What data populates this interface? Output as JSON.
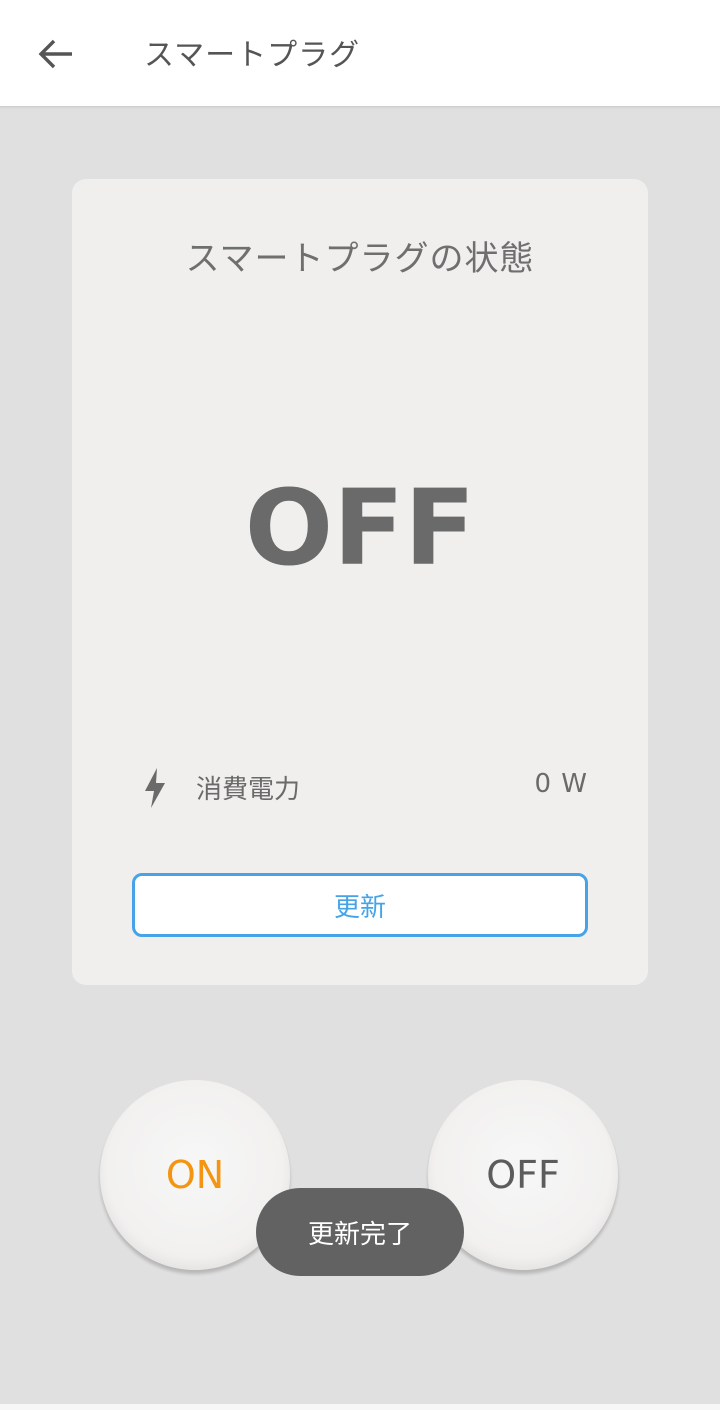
{
  "app_bar": {
    "title": "スマートプラグ",
    "back_icon": "arrow-left-icon"
  },
  "status_card": {
    "title": "スマートプラグの状態",
    "state": "OFF",
    "power": {
      "icon": "lightning-bolt-icon",
      "label": "消費電力",
      "value": "0 W"
    },
    "refresh_label": "更新"
  },
  "controls": {
    "on_label": "ON",
    "off_label": "OFF"
  },
  "toast": {
    "message": "更新完了"
  },
  "colors": {
    "accent_blue": "#46a3e8",
    "on_orange": "#f39510",
    "background": "#e0e0e0",
    "card": "#f0efed"
  }
}
